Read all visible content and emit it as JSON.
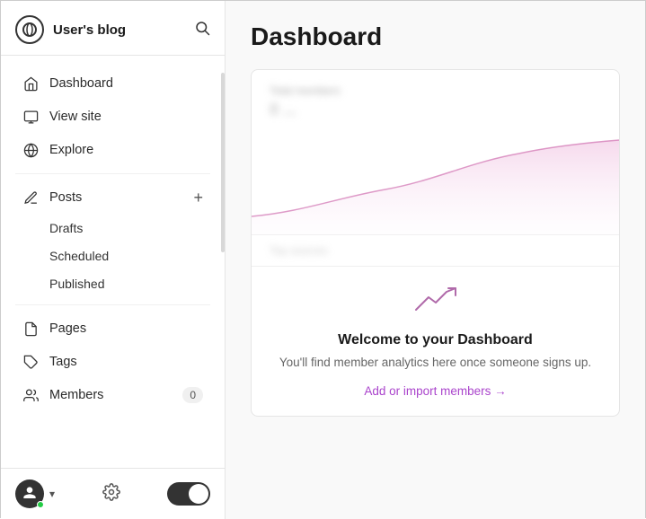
{
  "sidebar": {
    "brand": {
      "name": "User's blog"
    },
    "nav": {
      "dashboard": "Dashboard",
      "view_site": "View site",
      "explore": "Explore",
      "posts": "Posts",
      "drafts": "Drafts",
      "scheduled": "Scheduled",
      "published": "Published",
      "pages": "Pages",
      "tags": "Tags",
      "members": "Members",
      "members_badge": "0"
    },
    "footer": {
      "settings_icon": "⚙",
      "chevron": "∨"
    }
  },
  "main": {
    "title": "Dashboard",
    "card": {
      "label": "Total members",
      "value": "0 ...",
      "welcome_title": "Welcome to your Dashboard",
      "welcome_subtitle": "You'll find member analytics here once someone signs up.",
      "welcome_link": "Add or import members →",
      "footer_label": "Top sources"
    }
  }
}
